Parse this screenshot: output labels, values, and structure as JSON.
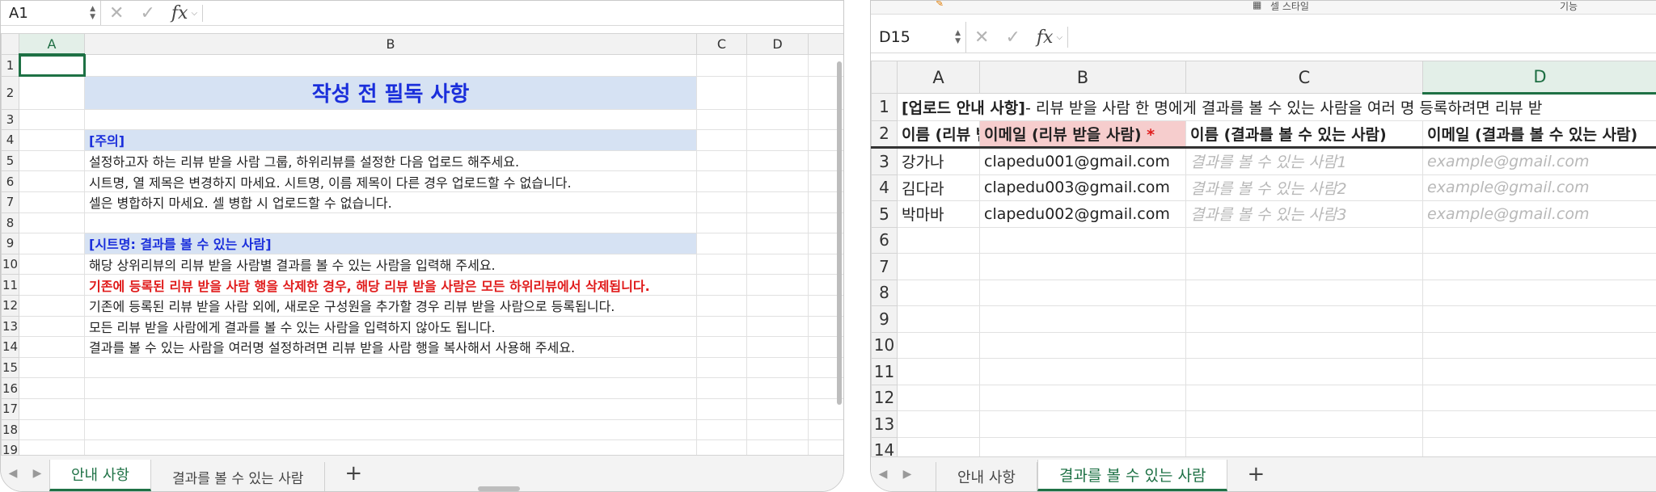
{
  "left": {
    "name_box": "A1",
    "fx_label": "fx",
    "columns": [
      "A",
      "B",
      "C",
      "D"
    ],
    "rows": [
      {
        "n": "1",
        "text": ""
      },
      {
        "n": "2",
        "text": "작성 전 필독 사항"
      },
      {
        "n": "3",
        "text": ""
      },
      {
        "n": "4",
        "text": "[주의]"
      },
      {
        "n": "5",
        "text": "설정하고자 하는 리뷰 받을 사람 그룹, 하위리뷰를 설정한 다음 업로드 해주세요."
      },
      {
        "n": "6",
        "text": "시트명, 열 제목은 변경하지 마세요. 시트명, 이름 제목이 다른 경우 업로드할 수 없습니다."
      },
      {
        "n": "7",
        "text": "셀은 병합하지 마세요. 셀 병합 시 업로드할 수 없습니다."
      },
      {
        "n": "8",
        "text": ""
      },
      {
        "n": "9",
        "text": "[시트명: 결과를 볼 수 있는 사람]"
      },
      {
        "n": "10",
        "text": "해당 상위리뷰의 리뷰 받을 사람별 결과를 볼 수 있는 사람을 입력해 주세요."
      },
      {
        "n": "11",
        "text": "기존에 등록된 리뷰 받을 사람 행을 삭제한 경우, 해당 리뷰 받을 사람은 모든 하위리뷰에서 삭제됩니다."
      },
      {
        "n": "12",
        "text": "기존에 등록된 리뷰 받을 사람 외에, 새로운 구성원을 추가할 경우 리뷰 받을 사람으로 등록됩니다."
      },
      {
        "n": "13",
        "text": "모든 리뷰 받을 사람에게 결과를 볼 수 있는 사람을 입력하지 않아도 됩니다."
      },
      {
        "n": "14",
        "text": "결과를 볼 수 있는 사람을 여러명 설정하려면 리뷰 받을 사람 행을 복사해서 사용해 주세요."
      },
      {
        "n": "15",
        "text": ""
      },
      {
        "n": "16",
        "text": ""
      },
      {
        "n": "17",
        "text": ""
      },
      {
        "n": "18",
        "text": ""
      },
      {
        "n": "19",
        "text": ""
      }
    ],
    "tabs": [
      "안내 사항",
      "결과를 볼 수 있는 사람"
    ],
    "add_sheet": "+"
  },
  "right": {
    "toolbar_frag_1": "셀 스타일",
    "toolbar_frag_2": "기능",
    "name_box": "D15",
    "fx_label": "fx",
    "columns": [
      "A",
      "B",
      "C",
      "D"
    ],
    "row1_bold": "[업로드 안내 사항]",
    "row1_rest": "- 리뷰 받을 사람 한 명에게 결과를 볼 수 있는 사람을 여러 명 등록하려면 리뷰 받",
    "headers": [
      "이름 (리뷰 받을 사람)",
      "이메일 (리뷰 받을 사람)",
      "이름 (결과를 볼 수 있는 사람)",
      "이메일 (결과를 볼 수 있는 사람)"
    ],
    "required_mark": "*",
    "data_rows": [
      {
        "n": "3",
        "name": "강가나",
        "email": "clapedu001@gmail.com",
        "viewer": "결과를 볼 수 있는 사람1",
        "viewer_email": "example@gmail.com"
      },
      {
        "n": "4",
        "name": "김다라",
        "email": "clapedu003@gmail.com",
        "viewer": "결과를 볼 수 있는 사람2",
        "viewer_email": "example@gmail.com"
      },
      {
        "n": "5",
        "name": "박마바",
        "email": "clapedu002@gmail.com",
        "viewer": "결과를 볼 수 있는 사람3",
        "viewer_email": "example@gmail.com"
      }
    ],
    "empty_rows": [
      "6",
      "7",
      "8",
      "9",
      "10",
      "11",
      "12",
      "13",
      "14"
    ],
    "row_numbers": [
      "1",
      "2"
    ],
    "tabs": [
      "안내 사항",
      "결과를 볼 수 있는 사람"
    ],
    "add_sheet": "+"
  },
  "colors": {
    "accent_green": "#1e7145",
    "title_blue": "#1a2edb",
    "warn_red": "#e01b1b",
    "band_blue": "#d6e2f3",
    "header_pink": "#f6cdcd"
  }
}
